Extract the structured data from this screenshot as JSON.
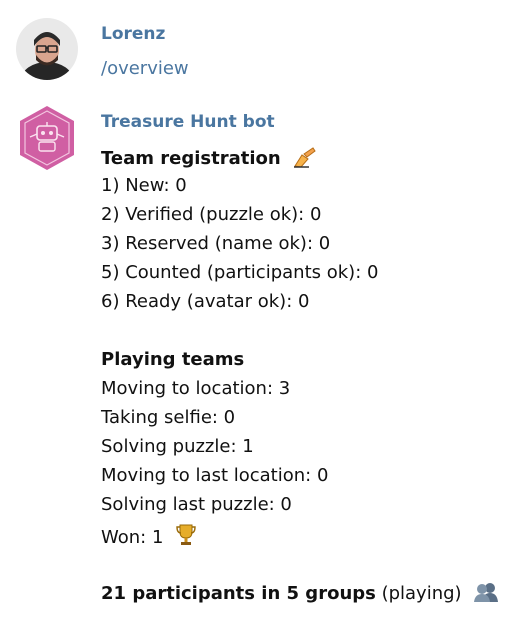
{
  "messages": [
    {
      "author": "Lorenz",
      "text": "/overview"
    },
    {
      "author": "Treasure Hunt bot",
      "registration": {
        "title": "Team registration",
        "items": [
          "1) New: 0",
          "2) Verified (puzzle ok): 0",
          "3) Reserved (name ok): 0",
          "5) Counted (participants ok): 0",
          "6) Ready (avatar ok): 0"
        ]
      },
      "playing": {
        "title": "Playing teams",
        "items": [
          "Moving to location: 3",
          "Taking selfie: 0",
          "Solving puzzle: 1",
          "Moving to last location: 0",
          "Solving last puzzle: 0",
          "Won: 1"
        ]
      },
      "summary": {
        "bold": "21 participants in 5 groups",
        "rest": " (playing)"
      }
    }
  ],
  "icons": {
    "registration_emoji": "writing-hand-icon",
    "won_emoji": "trophy-icon",
    "summary_emoji": "busts-icon",
    "bot_avatar": "bot-hexagon-avatar",
    "user_avatar": "user-photo-avatar"
  },
  "colors": {
    "author": "#4a76a0",
    "command": "#4a76a0",
    "bot_avatar_bg": "#d05fa3"
  }
}
